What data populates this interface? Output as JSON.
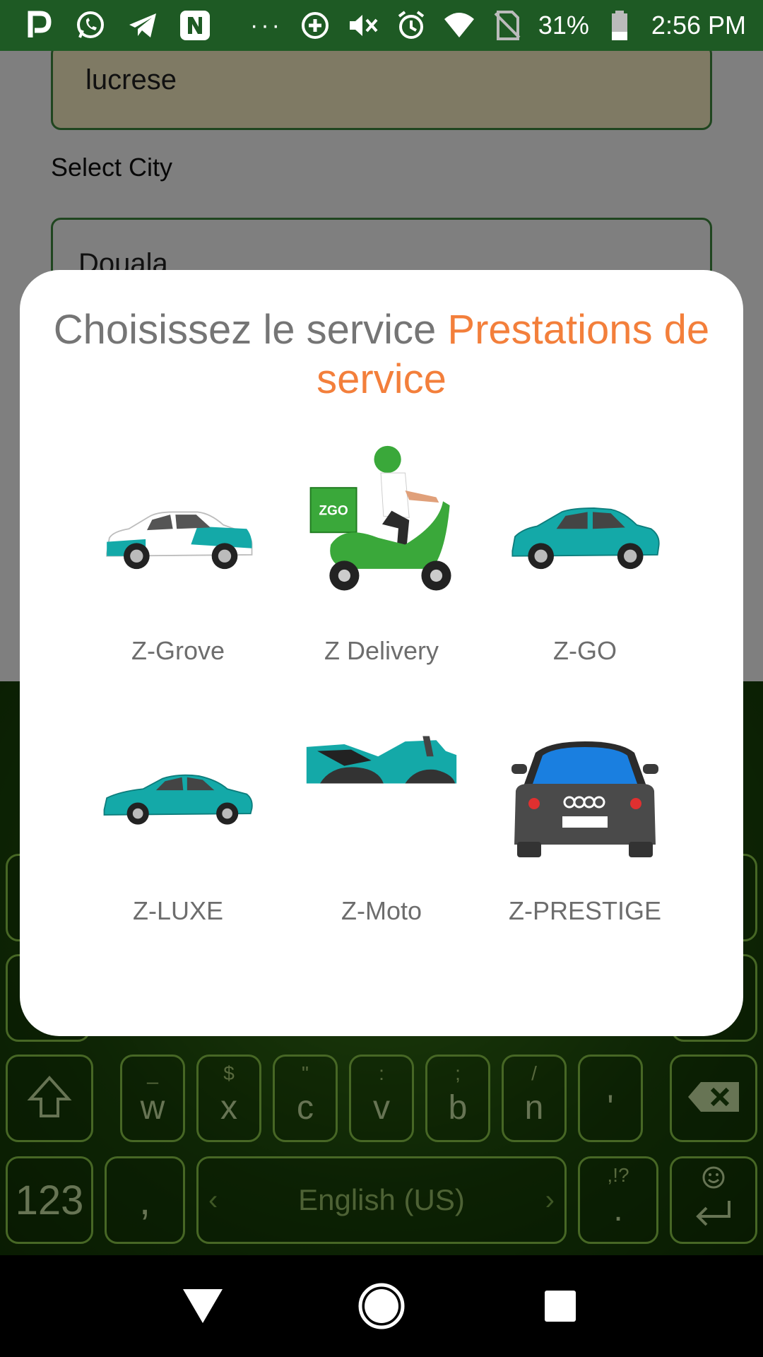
{
  "status_bar": {
    "battery": "31%",
    "time": "2:56 PM",
    "icons": [
      "p-icon",
      "whatsapp-icon",
      "telegram-icon",
      "n-icon",
      "add-circle-icon",
      "mute-icon",
      "alarm-icon",
      "wifi-icon",
      "no-sim-icon",
      "battery-icon"
    ]
  },
  "form": {
    "name_value": "lucrese",
    "city_label": "Select City",
    "city_value": "Douala"
  },
  "dialog": {
    "title_plain": "Choisissez le service ",
    "title_accent": "Prestations de service",
    "services": [
      {
        "label": "Z-Grove",
        "icon": "white-teal-hatchback-icon"
      },
      {
        "label": "Z Delivery",
        "icon": "delivery-scooter-icon"
      },
      {
        "label": "Z-GO",
        "icon": "teal-compact-car-icon"
      },
      {
        "label": "Z-LUXE",
        "icon": "teal-sedan-icon"
      },
      {
        "label": "Z-Moto",
        "icon": "motorcycle-icon"
      },
      {
        "label": "Z-PRESTIGE",
        "icon": "luxury-car-front-icon"
      }
    ]
  },
  "keyboard": {
    "row3": [
      {
        "hint": "_",
        "label": "w"
      },
      {
        "hint": "$",
        "label": "x"
      },
      {
        "hint": "\"",
        "label": "c"
      },
      {
        "hint": ":",
        "label": "v"
      },
      {
        "hint": ";",
        "label": "b"
      },
      {
        "hint": "/",
        "label": "n"
      },
      {
        "hint": "",
        "label": "'"
      }
    ],
    "numbers_label": "123",
    "comma_label": ",",
    "space_label": "English (US)",
    "period_hint": ",!?",
    "period_label": "."
  },
  "colors": {
    "status_bar": "#1e5a24",
    "accent": "#f37f3b",
    "title_gray": "#757575",
    "zgo_teal": "#14a9a8",
    "zgo_green": "#3aa83a"
  }
}
